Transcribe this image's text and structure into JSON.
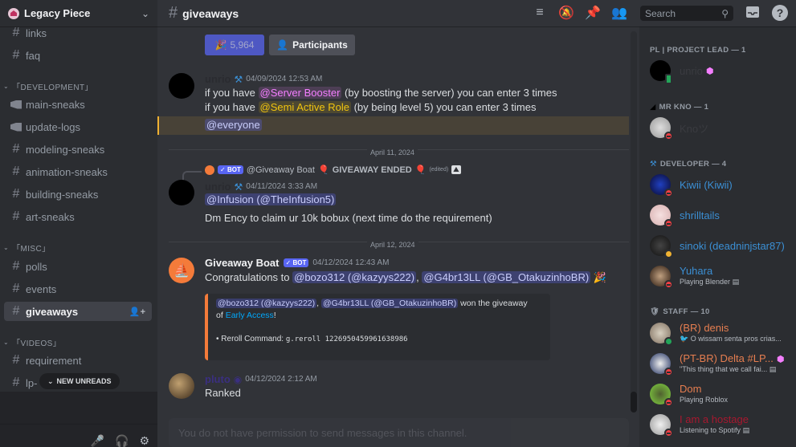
{
  "server": {
    "name": "Legacy Piece"
  },
  "sidebar": {
    "items": [
      {
        "type": "channel",
        "label": "links",
        "icon": "hash-lock-icon"
      },
      {
        "type": "channel",
        "label": "faq",
        "icon": "hash-lock-icon"
      },
      {
        "type": "category",
        "label": "「DEVELOPMENT」"
      },
      {
        "type": "channel",
        "label": "main-sneaks",
        "icon": "megaphone-icon"
      },
      {
        "type": "channel",
        "label": "update-logs",
        "icon": "megaphone-icon"
      },
      {
        "type": "channel",
        "label": "modeling-sneaks",
        "icon": "hash-lock-icon"
      },
      {
        "type": "channel",
        "label": "animation-sneaks",
        "icon": "hash-lock-icon"
      },
      {
        "type": "channel",
        "label": "building-sneaks",
        "icon": "hash-lock-icon"
      },
      {
        "type": "channel",
        "label": "art-sneaks",
        "icon": "hash-lock-icon"
      },
      {
        "type": "category",
        "label": "「MISC」"
      },
      {
        "type": "channel",
        "label": "polls",
        "icon": "hash-lock-icon"
      },
      {
        "type": "channel",
        "label": "events",
        "icon": "hash-lock-icon"
      },
      {
        "type": "channel",
        "label": "giveaways",
        "icon": "hash-lock-icon",
        "active": true
      },
      {
        "type": "category",
        "label": "「VIDEOS」"
      },
      {
        "type": "channel",
        "label": "requirement",
        "icon": "hash-lock-icon"
      },
      {
        "type": "channel",
        "label": "lp-",
        "icon": "hash-lock-icon"
      }
    ],
    "new_unreads": "NEW UNREADS"
  },
  "topbar": {
    "channel": "giveaways",
    "search_placeholder": "Search",
    "icons": [
      "threads-icon",
      "mute-bell-icon",
      "pin-icon",
      "members-icon"
    ]
  },
  "chat": {
    "giveaway_buttons": {
      "count": "5,964",
      "participants": "Participants"
    },
    "messages": [
      {
        "author": "unrio",
        "author_icon": "hammer-wrench-icon",
        "timestamp": "04/09/2024 12:53 AM",
        "line1_pre": "if you have ",
        "line1_role": "@Server Booster",
        "line1_post": "  (by boosting the server) you can enter 3 times",
        "line2_pre": "if you have ",
        "line2_role": "@Semi Active Role",
        "line2_post": " (by being level 5) you can enter 3 times",
        "line3_mention": "@everyone"
      },
      {
        "divider": "April 11, 2024",
        "reply_bot": "BOT",
        "reply_author": "@Giveaway Boat",
        "reply_text": "GIVEAWAY ENDED",
        "reply_edited": "(edited)",
        "author": "unrio",
        "timestamp": "04/11/2024 3:33 AM",
        "mention": "@Infusion (@TheInfusion5)",
        "text": "Dm Ency to claim ur 10k bobux (next time do the requirement)"
      },
      {
        "divider": "April 12, 2024",
        "author": "Giveaway Boat",
        "bot_tag": "BOT",
        "timestamp": "04/12/2024 12:43 AM",
        "text_pre": "Congratulations to ",
        "mention1": "@bozo312 (@kazyys222)",
        "sep": ", ",
        "mention2": "@G4br13LL (@GB_OtakuzinhoBR)",
        "embed": {
          "mention1": "@bozo312 (@kazyys222)",
          "sep": ", ",
          "mention2": "@G4br13LL (@GB_OtakuzinhoBR)",
          "won_text": " won the giveaway",
          "of_text": "of ",
          "prize": "Early Access",
          "excl": "!",
          "reroll_label": "• Reroll Command: ",
          "reroll_code": "g.reroll 1226950459961638986"
        }
      },
      {
        "author": "pluto",
        "timestamp": "04/12/2024 2:12 AM",
        "text": "Ranked"
      }
    ],
    "input_placeholder": "You do not have permission to send messages in this channel."
  },
  "members": {
    "groups": [
      {
        "label": "PL | PROJECT LEAD — 1",
        "members": [
          {
            "name": "unrio",
            "color": "#3a3b40",
            "status": "mobile",
            "boost": true
          }
        ]
      },
      {
        "label": "MR KNO — 1",
        "members": [
          {
            "name": "Knoツ",
            "color": "#3a3b40",
            "status": "dnd"
          }
        ]
      },
      {
        "label": "DEVELOPER — 4",
        "members": [
          {
            "name": "Kiwii (Kiwii)",
            "color": "#3b8fd4",
            "status": "dnd"
          },
          {
            "name": "shrilltails",
            "color": "#3b8fd4",
            "status": "dnd"
          },
          {
            "name": "sinoki (deadninjstar87)",
            "color": "#3b8fd4",
            "status": "idle"
          },
          {
            "name": "Yuhara",
            "color": "#3b8fd4",
            "status": "dnd",
            "activity": "Playing Blender"
          }
        ]
      },
      {
        "label": "STAFF — 10",
        "members": [
          {
            "name": "(BR) denis",
            "color": "#e67e50",
            "status": "online",
            "activity": "O wissam senta pros crias..."
          },
          {
            "name": "(PT-BR) Delta #LP...",
            "color": "#e67e50",
            "status": "dnd",
            "activity": "\"This thing that we call fai...",
            "boost": true
          },
          {
            "name": "Dom",
            "color": "#e67e50",
            "status": "dnd",
            "activity": "Playing Roblox"
          },
          {
            "name": "I am a hostage",
            "color": "#a8182f",
            "status": "dnd",
            "activity": "Listening to Spotify"
          }
        ]
      }
    ]
  }
}
